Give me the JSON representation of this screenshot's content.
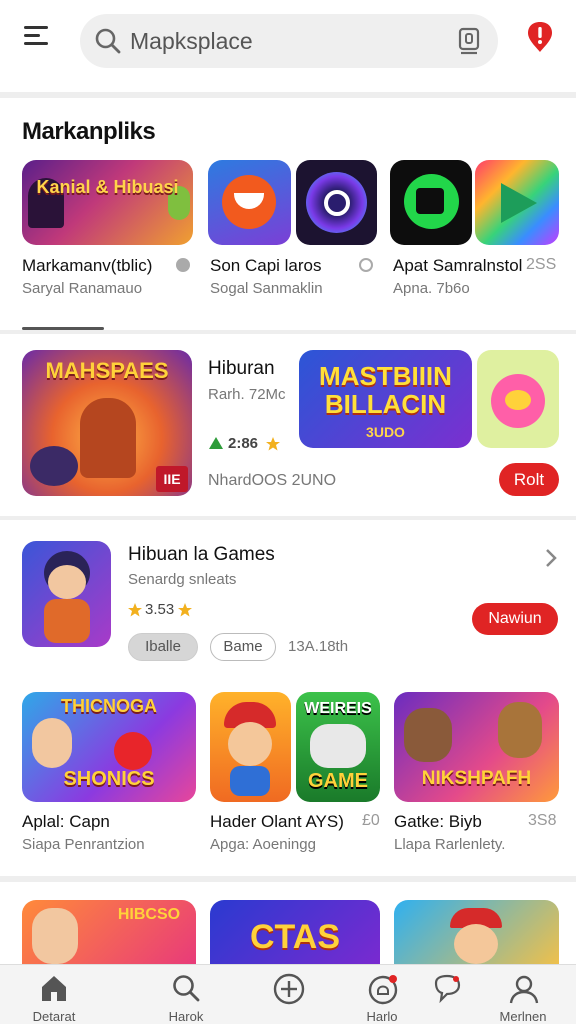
{
  "header": {
    "search_text": "Mapksplace",
    "menu_icon": "hamburger-menu-icon",
    "mic_icon": "voice-search-icon",
    "notification_icon": "alert-notification-icon"
  },
  "section1": {
    "title": "Markanpliks",
    "banner_text": "Kanial & Hibuasi",
    "apps": [
      {
        "name": "Markamanv(tblic)",
        "sub": "Saryal Ranamauo"
      },
      {
        "name": "Son Capi laros",
        "sub": "Sogal Sanmaklin"
      },
      {
        "name": "Apat Samralnstol",
        "sub": "Apna. 7b6o",
        "meta": "2SS"
      }
    ]
  },
  "section2": {
    "banner_text": "MAHSPAES",
    "banner_badge": "IIE",
    "title": "Hiburan",
    "sub": "Rarh. 72Mc",
    "rating": "2:86",
    "promo_text": "MASTBIIIN BILLACIN",
    "promo_sub": "3UDO",
    "meta": "NhardOOS 2UNO",
    "button": "Rolt"
  },
  "section3": {
    "title": "Hibuan la Games",
    "sub": "Senardg snleats",
    "rating": "3.53",
    "chip1": "Iballe",
    "chip2": "Bame",
    "meta": "13A.18th",
    "button": "Nawiun",
    "games": [
      {
        "banner": "SHONICS",
        "banner_top": "THICNOGA",
        "name": "Aplal: Capn",
        "sub": "Siapa Penrantzion"
      },
      {
        "banner": "",
        "name": "Hader Olant AYS)",
        "sub": "Apga: Aoeningg",
        "meta": "£0"
      },
      {
        "banner": "GAME",
        "banner_top": "WEIREIS",
        "name": "",
        "sub": ""
      },
      {
        "banner": "NIKSHPAFH",
        "name": "Gatke: Biyb",
        "sub": "Llapa Rarlenlety.",
        "meta": "3S8"
      }
    ]
  },
  "section4": {
    "banner_mid": "CTAS",
    "banner_small": "HIBCSO"
  },
  "bottom_nav": [
    {
      "label": "Detarat",
      "icon": "home-icon"
    },
    {
      "label": "Harok",
      "icon": "search-icon"
    },
    {
      "label": "",
      "icon": "add-circle-icon"
    },
    {
      "label": "Harlo",
      "icon": "notifications-icon"
    },
    {
      "label": "",
      "icon": "chat-icon"
    },
    {
      "label": "Merlnen",
      "icon": "profile-icon"
    }
  ],
  "colors": {
    "accent": "#e02424",
    "background": "#eeeeee",
    "card": "#ffffff"
  }
}
